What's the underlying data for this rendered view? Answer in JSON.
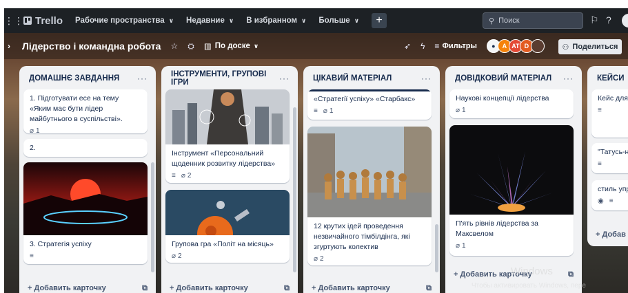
{
  "topnav": {
    "app_name": "Trello",
    "menus": [
      {
        "label": "Рабочие пространства"
      },
      {
        "label": "Недавние"
      },
      {
        "label": "В избранном"
      },
      {
        "label": "Больше"
      }
    ],
    "search_placeholder": "Поиск"
  },
  "board": {
    "title": "Лідерство і командна робота",
    "view_label": "По доске",
    "filters_label": "Фильтры",
    "share_label": "Поделиться",
    "members": [
      {
        "initials": "A",
        "color": "#f5820a"
      },
      {
        "initials": "AT",
        "color": "#e34935"
      },
      {
        "initials": "D",
        "color": "#e35b20"
      }
    ]
  },
  "lists": [
    {
      "title": "ДОМАШНЄ ЗАВДАННЯ",
      "cards": [
        {
          "text": "1. Підготувати есе на тему «Яким має бути лідер майбутнього в суспільстві».",
          "attachments": "1"
        },
        {
          "text": "2."
        },
        {
          "text": "3. Стратегія успіху"
        }
      ],
      "add_label": "Добавить карточку"
    },
    {
      "title": "ІНСТРУМЕНТИ, ГРУПОВІ ІГРИ",
      "cards": [
        {
          "text": "Інструмент «Персональний щоденник розвитку лідерства»",
          "attachments": "2"
        },
        {
          "text": "Групова гра «Політ на місяць»",
          "attachments": "2"
        }
      ],
      "add_label": "Добавить карточку"
    },
    {
      "title": "ЦІКАВИЙ МАТЕРІАЛ",
      "cards": [
        {
          "text": "«Стратегії успіху» «Старбакс»",
          "attachments": "1"
        },
        {
          "text": "12 крутих ідей проведення незвичайного тімбілдінга, які згуртують колектив",
          "attachments": "2"
        }
      ],
      "add_label": "Добавить карточку"
    },
    {
      "title": "ДОВІДКОВИЙ МАТЕРІАЛ",
      "cards": [
        {
          "text": "Наукові концепції лідерства",
          "attachments": "1"
        },
        {
          "text": "П'ять рівнів лідерства за Максвелом",
          "attachments": "1"
        }
      ],
      "add_label": "Добавить карточку"
    },
    {
      "title": "КЕЙСИ",
      "cards": [
        {
          "text": "Кейс для а найшанов планети?»"
        },
        {
          "text": "\"Татусь-на"
        },
        {
          "text": "стиль упр"
        }
      ],
      "add_label": "Добав"
    }
  ],
  "watermark": {
    "line1": "Windows",
    "line2": "Чтобы активировать Windows, пере"
  }
}
